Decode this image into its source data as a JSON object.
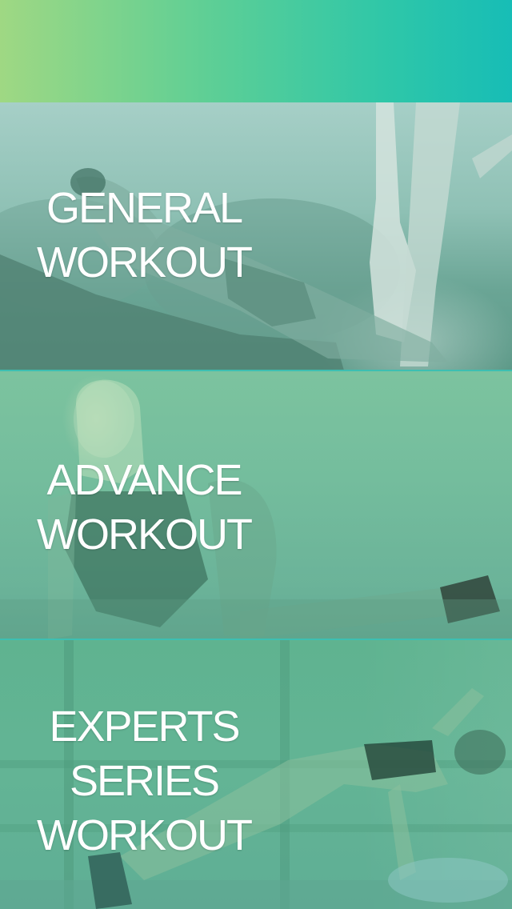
{
  "header": {
    "gradient_start": "#9fd883",
    "gradient_end": "#17bdb6"
  },
  "cards": [
    {
      "id": "general",
      "lines": [
        "GENERAL",
        "WORKOUT"
      ]
    },
    {
      "id": "advance",
      "lines": [
        "ADVANCE",
        "WORKOUT"
      ]
    },
    {
      "id": "experts",
      "lines": [
        "EXPERTS",
        "SERIES",
        "WORKOUT"
      ]
    }
  ],
  "colors": {
    "divider": "#3dbfb2",
    "text": "#ffffff"
  }
}
